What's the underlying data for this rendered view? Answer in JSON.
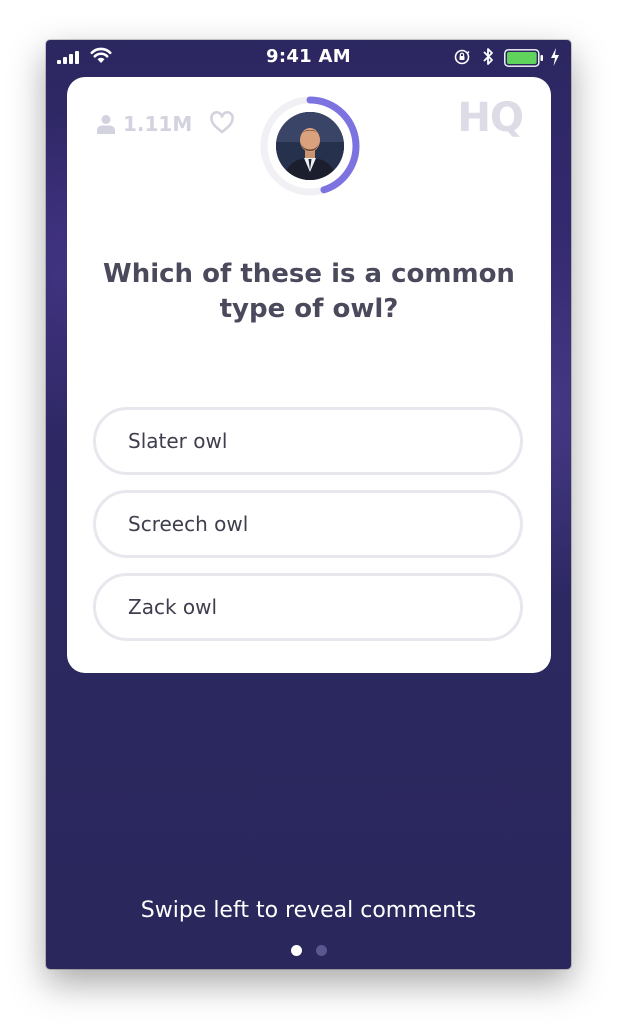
{
  "status_bar": {
    "time": "9:41 AM",
    "signal_icon": "cellular-signal-icon",
    "wifi_icon": "wifi-icon",
    "rotation_lock_icon": "rotation-lock-icon",
    "bluetooth_icon": "bluetooth-icon",
    "battery_icon": "battery-icon",
    "charging_icon": "charging-bolt-icon",
    "battery_color": "#5fd35c"
  },
  "card": {
    "viewer_count": "1.11M",
    "viewers_icon": "person-icon",
    "heart_icon": "heart-icon",
    "logo_text": "HQ",
    "timer_progress": 0.45,
    "question": "Which of these is a common type of owl?",
    "answers": [
      {
        "label": "Slater owl"
      },
      {
        "label": "Screech owl"
      },
      {
        "label": "Zack owl"
      }
    ]
  },
  "footer": {
    "hint": "Swipe left to reveal comments",
    "page_count": 2,
    "current_page": 1
  },
  "colors": {
    "background": "#2c2862",
    "card": "#ffffff",
    "timer_ring": "#7c72e0",
    "question_text": "#4a4a5c",
    "faded_ui": "#d3d3df"
  }
}
